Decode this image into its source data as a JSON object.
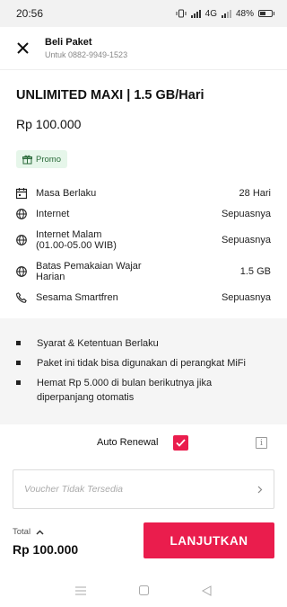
{
  "status_bar": {
    "time": "20:56",
    "network": "4G",
    "battery": "48%"
  },
  "header": {
    "title": "Beli Paket",
    "subtitle": "Untuk 0882-9949-1523"
  },
  "package": {
    "name": "UNLIMITED MAXI | 1.5 GB/Hari",
    "price": "Rp 100.000",
    "promo_label": "Promo"
  },
  "details": [
    {
      "icon": "calendar-icon",
      "label": "Masa Berlaku",
      "value": "28 Hari"
    },
    {
      "icon": "globe-icon",
      "label": "Internet",
      "value": "Sepuasnya"
    },
    {
      "icon": "globe-icon",
      "label": "Internet Malam\n(01.00-05.00 WIB)",
      "value": "Sepuasnya"
    },
    {
      "icon": "globe-icon",
      "label": "Batas Pemakaian Wajar\nHarian",
      "value": "1.5 GB"
    },
    {
      "icon": "phone-icon",
      "label": "Sesama Smartfren",
      "value": "Sepuasnya"
    }
  ],
  "notes": [
    "Syarat & Ketentuan Berlaku",
    "Paket ini tidak bisa digunakan di perangkat MiFi",
    "Hemat Rp 5.000 di bulan berikutnya jika diperpanjang otomatis"
  ],
  "auto_renewal": {
    "label": "Auto Renewal",
    "checked": true
  },
  "voucher": {
    "placeholder": "Voucher Tidak Tersedia"
  },
  "footer": {
    "total_label": "Total",
    "total_value": "Rp 100.000",
    "continue_label": "LANJUTKAN"
  },
  "colors": {
    "accent": "#ea1d4d",
    "promo_bg": "#e6f6ea",
    "promo_text": "#2a6b3a",
    "notes_bg": "#f5f5f5"
  }
}
